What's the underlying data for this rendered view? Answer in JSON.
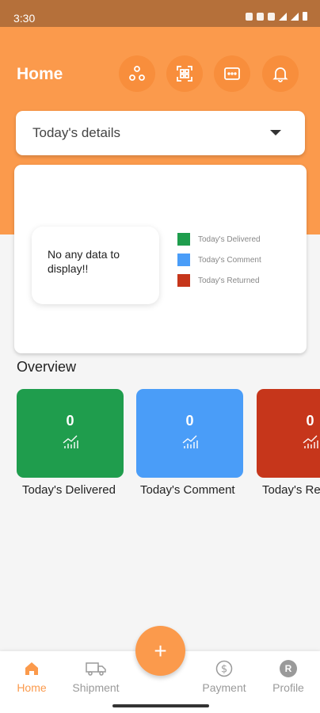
{
  "status_bar": {
    "time": "3:30"
  },
  "header": {
    "title": "Home"
  },
  "dropdown": {
    "label": "Today's details"
  },
  "chart": {
    "empty_message": "No any data to display!!",
    "legend": [
      {
        "label": "Today's Delivered",
        "color": "#1f9d4d"
      },
      {
        "label": "Today's Comment",
        "color": "#4a9df8"
      },
      {
        "label": "Today's Returned",
        "color": "#c6361b"
      }
    ]
  },
  "overview": {
    "title": "Overview",
    "cards": [
      {
        "value": "0",
        "label": "Today's Delivered",
        "color": "#1f9d4d"
      },
      {
        "value": "0",
        "label": "Today's Comment",
        "color": "#4a9df8"
      },
      {
        "value": "0",
        "label": "Today's Re",
        "color": "#c6361b"
      }
    ]
  },
  "nav": {
    "home": "Home",
    "shipment": "Shipment",
    "add": "+",
    "payment": "Payment",
    "profile": "Profile",
    "profile_initial": "R"
  },
  "colors": {
    "primary": "#fb9a4c",
    "status_bar": "#b5703a"
  }
}
